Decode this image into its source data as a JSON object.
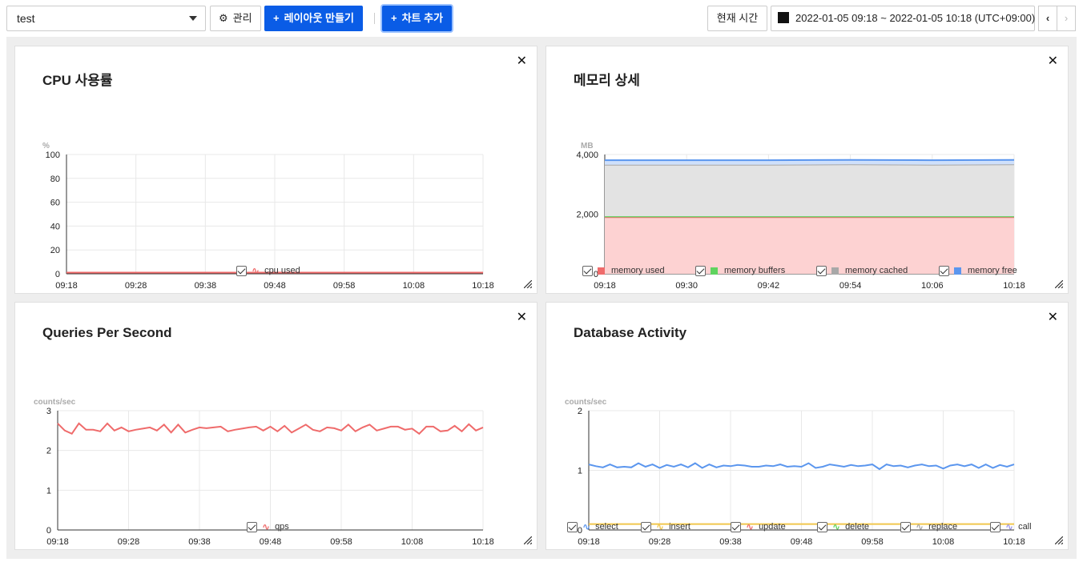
{
  "toolbar": {
    "select_value": "test",
    "manage_label": "관리",
    "make_layout_label": "레이아웃 만들기",
    "add_chart_label": "차트 추가",
    "now_label": "현재 시간",
    "range_label": "2022-01-05 09:18 ~ 2022-01-05 10:18 (UTC+09:00)",
    "prev": "‹",
    "next": "›"
  },
  "panels": {
    "cpu": {
      "title": "CPU 사용률",
      "unit": "%",
      "legend": [
        "cpu used"
      ]
    },
    "mem": {
      "title": "메모리 상세",
      "unit": "MB",
      "legend": [
        "memory used",
        "memory buffers",
        "memory cached",
        "memory free"
      ]
    },
    "qps": {
      "title": "Queries Per Second",
      "unit": "counts/sec",
      "legend": [
        "qps"
      ]
    },
    "db": {
      "title": "Database Activity",
      "unit": "counts/sec",
      "legend": [
        "select",
        "insert",
        "update",
        "delete",
        "replace",
        "call"
      ]
    }
  },
  "colors": {
    "red": "#ef6b6b",
    "green": "#5fd35f",
    "gray": "#a8a8a8",
    "blue": "#5b96ee",
    "yellow": "#f1c74d",
    "purple": "#9c97e8",
    "mem_used_fill": "#fdd2d2",
    "mem_cached_fill": "#e3e3e3"
  },
  "chart_data": [
    {
      "type": "line",
      "title": "CPU 사용률",
      "ylabel": "%",
      "ylim": [
        0,
        100
      ],
      "yticks": [
        "0",
        "20",
        "40",
        "60",
        "80",
        "100"
      ],
      "xticks": [
        "09:18",
        "09:28",
        "09:38",
        "09:48",
        "09:58",
        "10:08",
        "10:18"
      ],
      "series": [
        {
          "name": "cpu used",
          "values": [
            1,
            1,
            1,
            1,
            1,
            1,
            1
          ]
        }
      ]
    },
    {
      "type": "area",
      "title": "메모리 상세",
      "ylabel": "MB",
      "ylim": [
        0,
        4000
      ],
      "yticks": [
        "0",
        "2,000",
        "4,000"
      ],
      "xticks": [
        "09:18",
        "09:30",
        "09:42",
        "09:54",
        "10:06",
        "10:18"
      ],
      "series": [
        {
          "name": "memory used",
          "values": [
            1900,
            1900,
            1900,
            1900,
            1900,
            1900
          ]
        },
        {
          "name": "memory buffers",
          "values": [
            30,
            30,
            30,
            30,
            30,
            30
          ]
        },
        {
          "name": "memory cached",
          "values": [
            1730,
            1730,
            1730,
            1740,
            1730,
            1740
          ]
        },
        {
          "name": "memory free",
          "values": [
            150,
            150,
            150,
            150,
            150,
            150
          ]
        }
      ]
    },
    {
      "type": "line",
      "title": "Queries Per Second",
      "ylabel": "counts/sec",
      "ylim": [
        0,
        3
      ],
      "yticks": [
        "0",
        "1",
        "2",
        "3"
      ],
      "xticks": [
        "09:18",
        "09:28",
        "09:38",
        "09:48",
        "09:58",
        "10:08",
        "10:18"
      ],
      "series": [
        {
          "name": "qps",
          "values": [
            2.68,
            2.5,
            2.42,
            2.68,
            2.52,
            2.52,
            2.48,
            2.68,
            2.5,
            2.58,
            2.48,
            2.52,
            2.55,
            2.58,
            2.5,
            2.65,
            2.45,
            2.65,
            2.45,
            2.52,
            2.58,
            2.56,
            2.58,
            2.6,
            2.48,
            2.52,
            2.55,
            2.58,
            2.6,
            2.5,
            2.6,
            2.48,
            2.62,
            2.45,
            2.55,
            2.65,
            2.52,
            2.48,
            2.58,
            2.56,
            2.5,
            2.65,
            2.48,
            2.58,
            2.65,
            2.5,
            2.55,
            2.6,
            2.6,
            2.52,
            2.55,
            2.42,
            2.6,
            2.6,
            2.48,
            2.5,
            2.62,
            2.48,
            2.66,
            2.5,
            2.58
          ]
        }
      ]
    },
    {
      "type": "line",
      "title": "Database Activity",
      "ylabel": "counts/sec",
      "ylim": [
        0,
        2
      ],
      "yticks": [
        "0",
        "1",
        "2"
      ],
      "xticks": [
        "09:18",
        "09:28",
        "09:38",
        "09:48",
        "09:58",
        "10:08",
        "10:18"
      ],
      "series": [
        {
          "name": "select",
          "values": [
            1.1,
            1.07,
            1.05,
            1.1,
            1.05,
            1.06,
            1.05,
            1.12,
            1.06,
            1.1,
            1.04,
            1.09,
            1.06,
            1.1,
            1.05,
            1.12,
            1.04,
            1.1,
            1.05,
            1.08,
            1.07,
            1.09,
            1.08,
            1.06,
            1.06,
            1.08,
            1.07,
            1.1,
            1.06,
            1.07,
            1.06,
            1.12,
            1.04,
            1.06,
            1.1,
            1.08,
            1.06,
            1.09,
            1.07,
            1.08,
            1.1,
            1.02,
            1.1,
            1.07,
            1.08,
            1.05,
            1.08,
            1.1,
            1.07,
            1.08,
            1.03,
            1.08,
            1.1,
            1.07,
            1.1,
            1.04,
            1.1,
            1.04,
            1.09,
            1.06,
            1.1
          ]
        },
        {
          "name": "insert",
          "values": [
            0.1,
            0.1,
            0.1,
            0.1,
            0.1,
            0.1,
            0.1
          ]
        },
        {
          "name": "update",
          "values": []
        },
        {
          "name": "delete",
          "values": []
        },
        {
          "name": "replace",
          "values": []
        },
        {
          "name": "call",
          "values": []
        }
      ]
    }
  ]
}
